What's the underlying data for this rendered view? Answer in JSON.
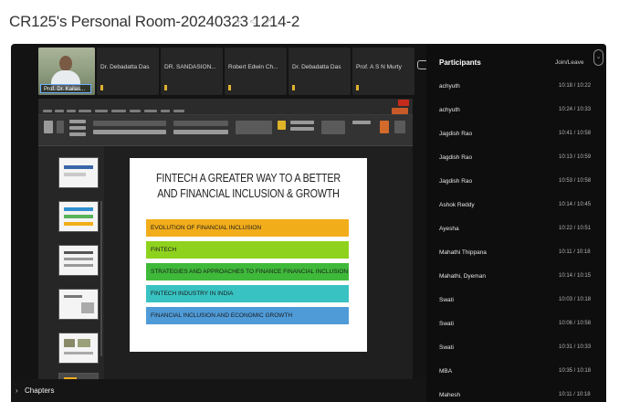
{
  "window": {
    "title": "CR125's Personal Room-20240323 1214-2"
  },
  "title_icons": {
    "add_icon": "plus-icon",
    "share_icon": "share-icon",
    "edit_icon": "pencil-icon",
    "glyphs": "+ < ↗"
  },
  "videos": {
    "self_label": "Prof. Dr. Kailas...",
    "tiles": [
      {
        "name": "Dr. Debadatta Das"
      },
      {
        "name": "DR. SANDASION..."
      },
      {
        "name": "Robert Edwin Ch..."
      },
      {
        "name": "Dr. Debadatta Das"
      },
      {
        "name": "Prof. A S N Murty"
      }
    ]
  },
  "slide": {
    "title": "FINTECH A GREATER WAY TO A BETTER AND FINANCIAL INCLUSION & GROWTH",
    "bars": [
      {
        "text": "EVOLUTION OF FINANCIAL INCLUSION",
        "color": "#f2ad1b"
      },
      {
        "text": "FINTECH",
        "color": "#8fd21e"
      },
      {
        "text": "STRATEGIES AND APPROACHES TO FINANCE FINANCIAL INCLUSION",
        "color": "#3fb93a"
      },
      {
        "text": "FINTECH INDUSTRY IN INDIA",
        "color": "#39c2c2"
      },
      {
        "text": "FINANCIAL INCLUSION AND ECONOMIC GROWTH",
        "color": "#4f9bd8"
      }
    ]
  },
  "participants": {
    "header": "Participants",
    "join_leave": "Join/Leave",
    "rows": [
      {
        "name": "achyuth",
        "time": "10:18 / 10:22"
      },
      {
        "name": "achyuth",
        "time": "10:24 / 10:33"
      },
      {
        "name": "Jagdish Rao",
        "time": "10:41 / 10:58"
      },
      {
        "name": "Jagdish Rao",
        "time": "10:13 / 10:59"
      },
      {
        "name": "Jagdish Rao",
        "time": "10:53 / 10:58"
      },
      {
        "name": "Ashok Reddy",
        "time": "10:14 / 10:45"
      },
      {
        "name": "Ayesha",
        "time": "10:22 / 10:51"
      },
      {
        "name": "Mahathi Thippana",
        "time": "10:11 / 10:18"
      },
      {
        "name": "Mahathi, Dyeman",
        "time": "10:14 / 10:15"
      },
      {
        "name": "Swati",
        "time": "10:03 / 10:18"
      },
      {
        "name": "Swati",
        "time": "10:06 / 10:58"
      },
      {
        "name": "Swati",
        "time": "10:31 / 10:33"
      },
      {
        "name": "MBA",
        "time": "10:35 / 10:18"
      },
      {
        "name": "Mahesh",
        "time": "10:11 / 10:18"
      }
    ]
  },
  "footer": {
    "chapters_label": "Chapters",
    "chevron_icon": "chevron-right-icon"
  },
  "colors": {
    "player_bg": "#131313",
    "panel_bg": "#0e0e0e",
    "accent": "#6ab0ff"
  }
}
